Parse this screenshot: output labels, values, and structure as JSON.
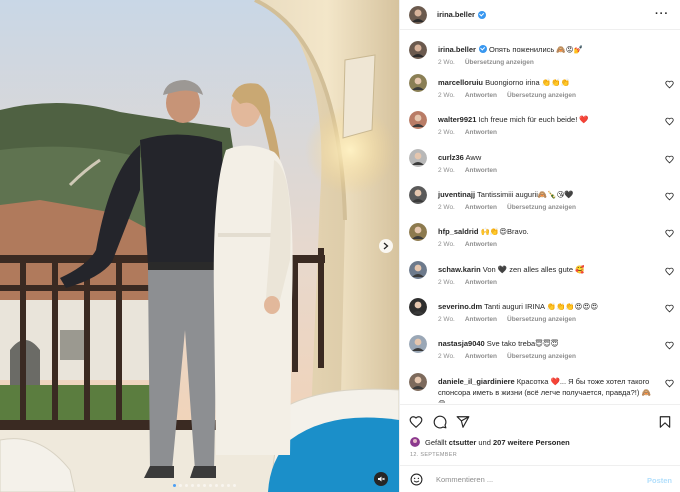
{
  "post": {
    "username": "irina.beller",
    "verified": true,
    "more_icon": "more-horizontal-icon",
    "photo_alt": "Couple kissing on a balcony",
    "carousel": {
      "total": 11,
      "active": 0
    }
  },
  "caption": {
    "username": "irina.beller",
    "text": "Опять поженились 🙈😡💅",
    "time": "2 Wo.",
    "translate": "Übersetzung anzeigen"
  },
  "comments": [
    {
      "username": "marcelloruiu",
      "text": "Buongiorno irina 👏👏👏",
      "time": "2 Wo.",
      "reply": "Antworten",
      "translate": "Übersetzung anzeigen",
      "avatar_color": "#8a7f55"
    },
    {
      "username": "walter9921",
      "text": "Ich freue mich für euch beide! ❤️",
      "time": "2 Wo.",
      "reply": "Antworten",
      "translate": "",
      "avatar_color": "#b97c66"
    },
    {
      "username": "curlz36",
      "text": "Aww",
      "time": "2 Wo.",
      "reply": "Antworten",
      "translate": "",
      "avatar_color": "#b8b8b8"
    },
    {
      "username": "juventinajj",
      "text": "Tantissimiii augurii🙈🍾😘🖤",
      "time": "2 Wo.",
      "reply": "Antworten",
      "translate": "Übersetzung anzeigen",
      "avatar_color": "#5a5a5a"
    },
    {
      "username": "hfp_saldrid",
      "text": "🙌👏😍Bravo.",
      "time": "2 Wo.",
      "reply": "Antworten",
      "translate": "",
      "avatar_color": "#8d7a4e"
    },
    {
      "username": "schaw.karin",
      "text": "Von 🖤 zen alles alles gute 🥰",
      "time": "2 Wo.",
      "reply": "Antworten",
      "translate": "",
      "avatar_color": "#6d7a8c"
    },
    {
      "username": "severino.dm",
      "text": "Tanti auguri IRINA 👏👏👏😍😍😍",
      "time": "2 Wo.",
      "reply": "Antworten",
      "translate": "Übersetzung anzeigen",
      "avatar_color": "#2e2e2e"
    },
    {
      "username": "nastasja9040",
      "text": "Sve tako treba😇😇😇",
      "time": "2 Wo.",
      "reply": "Antworten",
      "translate": "Übersetzung anzeigen",
      "avatar_color": "#9aa7b6"
    },
    {
      "username": "daniele_il_giardiniere",
      "text": "Красотка ❤️... Я бы тоже хотел такого спонсора иметь в жизни (всё легче получается, правда?!) 🙈😄",
      "time": "",
      "reply": "",
      "translate": "",
      "avatar_color": "#7d6a5c"
    }
  ],
  "actions": {
    "like_icon": "heart-icon",
    "comment_icon": "comment-icon",
    "share_icon": "share-icon",
    "save_icon": "bookmark-icon"
  },
  "likes": {
    "prefix": "Gefällt",
    "user": "ctsutter",
    "connector": "und",
    "others": "207 weitere Personen"
  },
  "date": "12. SEPTEMBER",
  "add_comment": {
    "emoji_icon": "emoji-icon",
    "placeholder": "Kommentieren ...",
    "post_label": "Posten"
  },
  "colors": {
    "verified": "#3897f0",
    "active_dot": "#4c9ff5",
    "post_button": "#b2dffc",
    "heart_red": "#ed4956"
  }
}
